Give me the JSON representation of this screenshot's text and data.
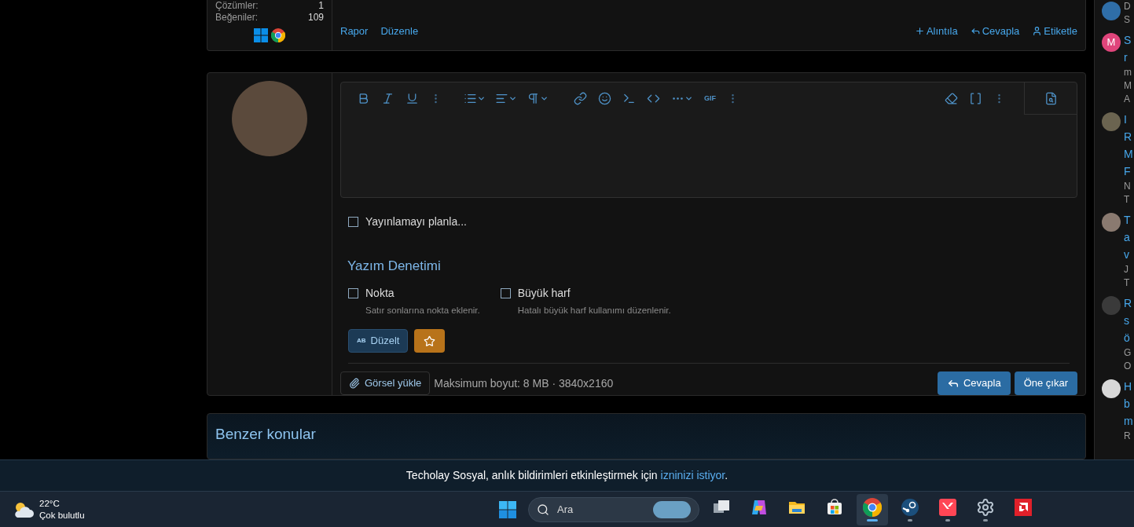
{
  "post": {
    "stats": [
      {
        "label": "Çözümler:",
        "value": "1"
      },
      {
        "label": "Beğeniler:",
        "value": "109"
      }
    ],
    "left_actions": [
      "Rapor",
      "Düzenle"
    ],
    "right_actions": [
      {
        "kind": "plus",
        "label": "Alıntıla"
      },
      {
        "kind": "reply",
        "label": "Cevapla"
      },
      {
        "kind": "user",
        "label": "Etiketle"
      }
    ]
  },
  "reply_form": {
    "toolbar": {
      "gif_label": "GIF"
    },
    "schedule": {
      "label": "Yayınlamayı planla...",
      "checked": false
    },
    "spellcheck": {
      "title": "Yazım Denetimi",
      "options": [
        {
          "label": "Nokta",
          "hint": "Satır sonlarına nokta eklenir.",
          "checked": false
        },
        {
          "label": "Büyük harf",
          "hint": "Hatalı büyük harf kullanımı düzenlenir.",
          "checked": false
        }
      ],
      "fix_icon_text": "AB",
      "fix_button": "Düzelt"
    },
    "upload_button": "Görsel yükle",
    "upload_limits": "Maksimum boyut: 8 MB · 3840x2160",
    "submit_buttons": [
      "Cevapla",
      "Öne çıkar"
    ]
  },
  "similar": {
    "title": "Benzer konular"
  },
  "sidebar": [
    {
      "kind": "photo",
      "color": "#2f6ea8",
      "lines": [
        {
          "kind": "meta",
          "text": "D"
        },
        {
          "kind": "meta",
          "text": "S"
        }
      ]
    },
    {
      "kind": "letter",
      "letter": "M",
      "color": "#e0457b",
      "lines": [
        {
          "kind": "title",
          "text": "S"
        },
        {
          "kind": "title",
          "text": "r"
        },
        {
          "kind": "meta",
          "text": "m"
        },
        {
          "kind": "meta",
          "text": "M"
        },
        {
          "kind": "meta",
          "text": "A"
        }
      ]
    },
    {
      "kind": "photo",
      "color": "#6b6450",
      "lines": [
        {
          "kind": "title",
          "text": "I"
        },
        {
          "kind": "title",
          "text": "R"
        },
        {
          "kind": "title",
          "text": "M"
        },
        {
          "kind": "title",
          "text": "F"
        },
        {
          "kind": "meta",
          "text": "N"
        },
        {
          "kind": "meta",
          "text": "T"
        }
      ]
    },
    {
      "kind": "photo",
      "color": "#8a7a70",
      "lines": [
        {
          "kind": "title",
          "text": "T"
        },
        {
          "kind": "title",
          "text": "a"
        },
        {
          "kind": "title",
          "text": "v"
        },
        {
          "kind": "meta",
          "text": "J"
        },
        {
          "kind": "meta",
          "text": "T"
        }
      ]
    },
    {
      "kind": "photo",
      "color": "#3a3a3a",
      "lines": [
        {
          "kind": "title",
          "text": "R"
        },
        {
          "kind": "title",
          "text": "s"
        },
        {
          "kind": "title",
          "text": "ö"
        },
        {
          "kind": "meta",
          "text": "G"
        },
        {
          "kind": "meta",
          "text": "O"
        }
      ]
    },
    {
      "kind": "photo",
      "color": "#d8d8d8",
      "lines": [
        {
          "kind": "title",
          "text": "H"
        },
        {
          "kind": "title",
          "text": "b"
        },
        {
          "kind": "title",
          "text": "m"
        },
        {
          "kind": "meta",
          "text": "R"
        }
      ]
    }
  ],
  "notification": {
    "text": "Techolay Sosyal, anlık bildirimleri etkinleştirmek için",
    "link": "izninizi istiyor",
    "end": "."
  },
  "taskbar": {
    "weather": {
      "temp": "22°C",
      "desc": "Çok bulutlu"
    },
    "search": {
      "placeholder": "Ara"
    },
    "apps": [
      {
        "kind": "taskview",
        "running": false,
        "active": false
      },
      {
        "kind": "copilot",
        "running": false,
        "active": false
      },
      {
        "kind": "folder",
        "running": false,
        "active": false
      },
      {
        "kind": "store",
        "running": false,
        "active": false
      },
      {
        "kind": "chrome",
        "running": true,
        "active": true
      },
      {
        "kind": "steam",
        "running": true,
        "active": false
      },
      {
        "kind": "valorant",
        "running": true,
        "active": false
      },
      {
        "kind": "settings",
        "running": true,
        "active": false
      },
      {
        "kind": "amd",
        "running": false,
        "active": false
      }
    ]
  }
}
